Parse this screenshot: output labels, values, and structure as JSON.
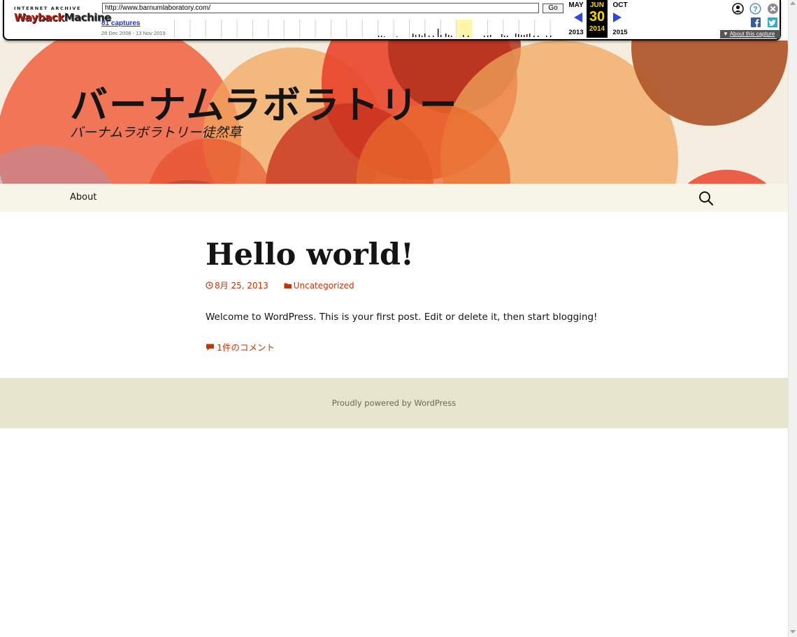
{
  "wayback": {
    "logo_top": "INTERNET ARCHIVE",
    "logo_main_a": "Wayback",
    "logo_main_b": "Machine",
    "url_value": "http://www.barnumlaboratory.com/",
    "go_label": "Go",
    "captures_label": "81 captures",
    "date_range": "28 Dec 2008 - 13 Nov 2019",
    "prev_month": "MAY",
    "cur_month": "JUN",
    "next_month": "OCT",
    "cur_day": "30",
    "prev_year": "2013",
    "cur_year": "2014",
    "next_year": "2015",
    "about_label": "About this capture",
    "icons": [
      "user-icon",
      "help-icon",
      "close-icon",
      "facebook-icon",
      "twitter-icon"
    ]
  },
  "site": {
    "title": "バーナムラボラトリー",
    "description": "バーナムラボラトリー徒然草"
  },
  "nav": {
    "about_label": "About",
    "search_icon": "search-icon"
  },
  "post": {
    "title": "Hello world!",
    "date": "8月 25, 2013",
    "category": "Uncategorized",
    "body": "Welcome to WordPress. This is your first post. Edit or delete it, then start blogging!",
    "comments": "1件のコメント"
  },
  "footer": {
    "text": "Proudly powered by WordPress"
  },
  "colors": {
    "link": "#bc360a",
    "navbar": "#f7f5e7",
    "footer": "#e8e5ce",
    "wayback_accent": "#2c49d8",
    "wayback_current": "#ffd600"
  }
}
